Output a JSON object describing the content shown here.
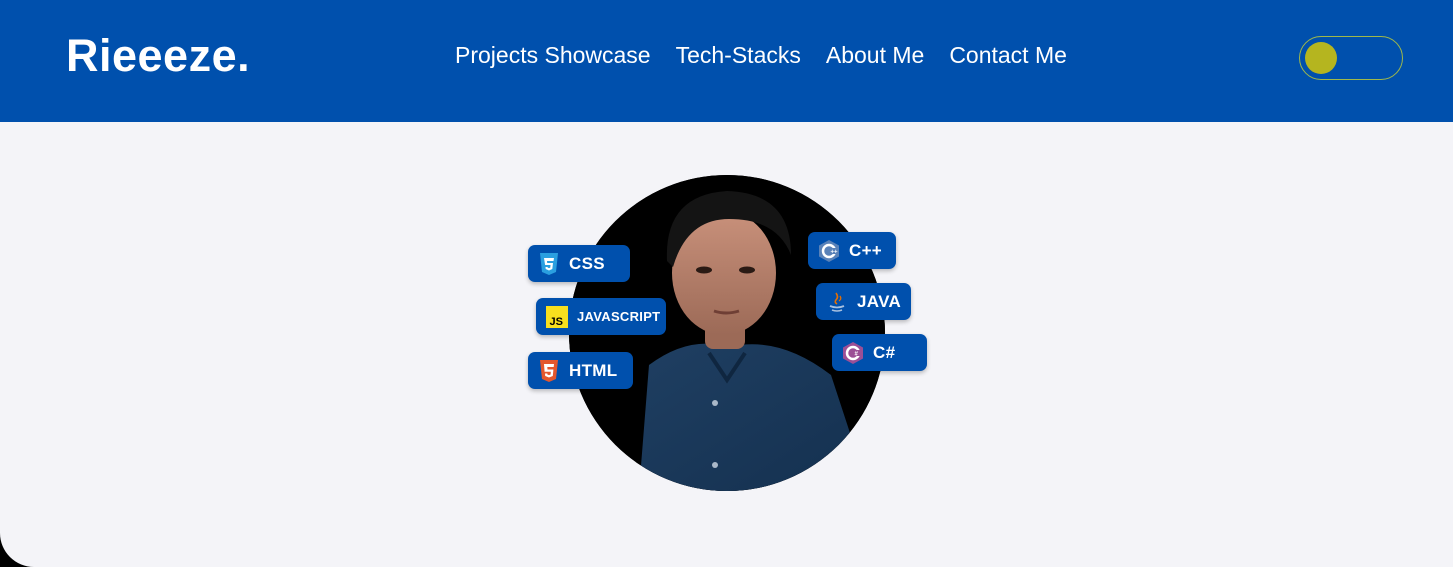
{
  "header": {
    "logo": "Rieeeze.",
    "nav": [
      "Projects Showcase",
      "Tech-Stacks",
      "About Me",
      "Contact Me"
    ],
    "theme_toggle_icon": "toggle-switch"
  },
  "hero": {
    "avatar_icon": "profile-photo",
    "badges": {
      "css": "CSS",
      "javascript": "JAVASCRIPT",
      "html": "HTML",
      "cpp": "C++",
      "java": "JAVA",
      "csharp": "C#"
    }
  },
  "colors": {
    "header_bg": "#0050ad",
    "page_bg": "#f4f4f8",
    "toggle_knob": "#b5b51f",
    "badge_bg": "#0050ad"
  }
}
